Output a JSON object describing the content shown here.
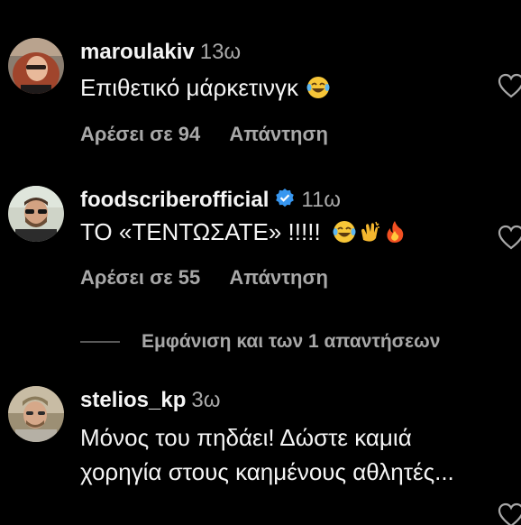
{
  "comments": [
    {
      "username": "maroulakiv",
      "time": "13ω",
      "text": "Επιθετικό μάρκετινγκ",
      "emojis": [
        "laughing-tears"
      ],
      "likes_label": "Αρέσει σε 94",
      "reply_label": "Απάντηση",
      "verified": false
    },
    {
      "username": "foodscriberofficial",
      "time": "11ω",
      "text": "ΤΟ «ΤΕΝΤΩΣΑΤΕ» !!!!!",
      "emojis": [
        "laughing-tears",
        "clapping-hands",
        "fire"
      ],
      "likes_label": "Αρέσει σε 55",
      "reply_label": "Απάντηση",
      "verified": true
    },
    {
      "username": "stelios_kp",
      "time": "3ω",
      "text": "Μόνος του πηδάει! Δώστε καμιά χορηγία στους καημένους αθλητές...",
      "verified": false
    }
  ],
  "view_replies_label": "Εμφάνιση και των 1 απαντήσεων",
  "colors": {
    "background": "#000000",
    "primary_text": "#f5f5f5",
    "secondary_text": "#a8a8a8",
    "verified": "#3897f0"
  },
  "icons": [
    "heart-outline-icon",
    "verified-badge-icon"
  ]
}
